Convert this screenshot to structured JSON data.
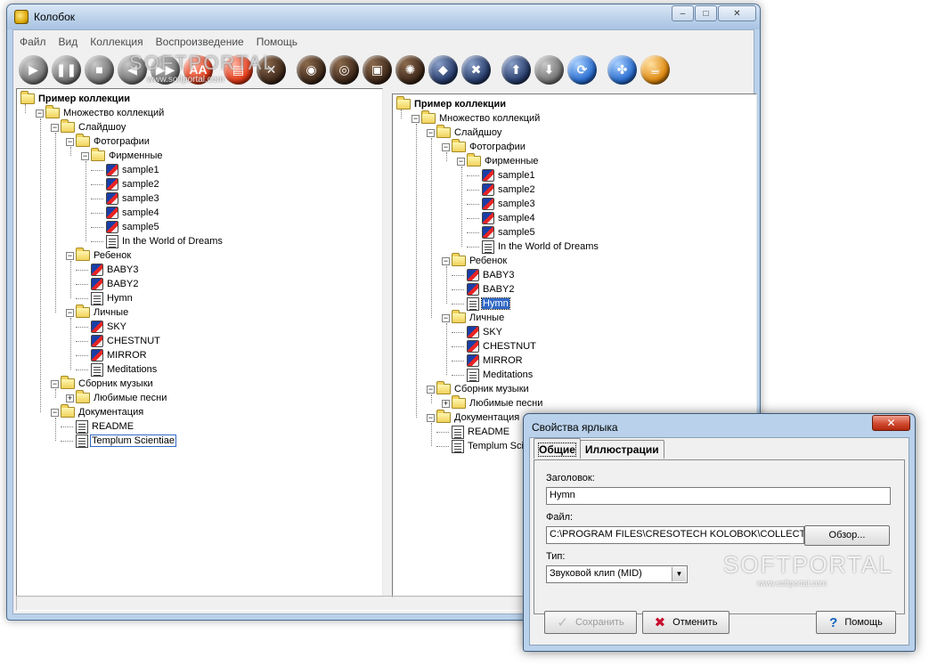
{
  "app": {
    "title": "Колобок",
    "window_buttons": {
      "minimize": "–",
      "maximize": "□",
      "close": "✕"
    },
    "watermark": {
      "logo": "SOFTPORTAL",
      "url": "www.softportal.com"
    }
  },
  "menu": [
    "Файл",
    "Вид",
    "Коллекция",
    "Воспроизведение",
    "Помощь"
  ],
  "toolbar": [
    {
      "name": "play-icon",
      "glyph": "▶",
      "style": "grey"
    },
    {
      "name": "pause-icon",
      "glyph": "❚❚",
      "style": "grey"
    },
    {
      "name": "stop-icon",
      "glyph": "■",
      "style": "grey"
    },
    {
      "name": "previous-icon",
      "glyph": "◀",
      "style": "grey"
    },
    {
      "name": "next-icon",
      "glyph": "▶▶",
      "style": "grey"
    },
    {
      "name": "font-icon",
      "glyph": "AA",
      "style": "red"
    },
    {
      "name": "print-icon",
      "glyph": "▤",
      "style": "red"
    },
    {
      "name": "tools-icon",
      "glyph": "✕",
      "style": "dark"
    },
    {
      "name": "ring-icon",
      "glyph": "◉",
      "style": "dark"
    },
    {
      "name": "ring-alt-icon",
      "glyph": "◎",
      "style": "dark"
    },
    {
      "name": "window-icon",
      "glyph": "▣",
      "style": "dark"
    },
    {
      "name": "settings-icon",
      "glyph": "✺",
      "style": "dark"
    },
    {
      "name": "tag-icon",
      "glyph": "◆",
      "style": "navy"
    },
    {
      "name": "delete-icon",
      "glyph": "✖",
      "style": "navy"
    },
    {
      "name": "move-up-icon",
      "glyph": "⬆",
      "style": "navy"
    },
    {
      "name": "move-down-icon",
      "glyph": "⬇",
      "style": "grey"
    },
    {
      "name": "refresh-icon",
      "glyph": "⟳",
      "style": "blue"
    },
    {
      "name": "fan-icon",
      "glyph": "✤",
      "style": "blue"
    },
    {
      "name": "cup-icon",
      "glyph": "☕",
      "style": "orange"
    }
  ],
  "tree_left": [
    {
      "label": "Пример коллекции",
      "icon": "folder",
      "level": 0,
      "exp": "",
      "bold": true
    },
    {
      "label": "Множество коллекций",
      "icon": "folder",
      "level": 1,
      "exp": "−"
    },
    {
      "label": "Слайдшоу",
      "icon": "folder",
      "level": 2,
      "exp": "−"
    },
    {
      "label": "Фотографии",
      "icon": "folder",
      "level": 3,
      "exp": "−"
    },
    {
      "label": "Фирменные",
      "icon": "folder",
      "level": 4,
      "exp": "−"
    },
    {
      "label": "sample1",
      "icon": "media",
      "level": 5
    },
    {
      "label": "sample2",
      "icon": "media",
      "level": 5
    },
    {
      "label": "sample3",
      "icon": "media",
      "level": 5
    },
    {
      "label": "sample4",
      "icon": "media",
      "level": 5
    },
    {
      "label": "sample5",
      "icon": "media",
      "level": 5
    },
    {
      "label": "In the World of Dreams",
      "icon": "doc",
      "level": 5
    },
    {
      "label": "Ребенок",
      "icon": "folder",
      "level": 3,
      "exp": "−"
    },
    {
      "label": "BABY3",
      "icon": "media",
      "level": 4
    },
    {
      "label": "BABY2",
      "icon": "media",
      "level": 4
    },
    {
      "label": "Hymn",
      "icon": "doc",
      "level": 4
    },
    {
      "label": "Личные",
      "icon": "folder",
      "level": 3,
      "exp": "−"
    },
    {
      "label": "SKY",
      "icon": "media",
      "level": 4
    },
    {
      "label": "CHESTNUT",
      "icon": "media",
      "level": 4
    },
    {
      "label": "MIRROR",
      "icon": "media",
      "level": 4
    },
    {
      "label": "Meditations",
      "icon": "doc",
      "level": 4
    },
    {
      "label": "Сборник музыки",
      "icon": "folder",
      "level": 2,
      "exp": "−"
    },
    {
      "label": "Любимые песни",
      "icon": "folder",
      "level": 3,
      "exp": "+"
    },
    {
      "label": "Документация",
      "icon": "folder",
      "level": 2,
      "exp": "−"
    },
    {
      "label": "README",
      "icon": "doc",
      "level": 3
    },
    {
      "label": "Templum Scientiae",
      "icon": "doc",
      "level": 3,
      "focus": true
    }
  ],
  "tree_right": [
    {
      "label": "Пример коллекции",
      "icon": "folder",
      "level": 0,
      "exp": "",
      "bold": true
    },
    {
      "label": "Множество коллекций",
      "icon": "folder",
      "level": 1,
      "exp": "−"
    },
    {
      "label": "Слайдшоу",
      "icon": "folder",
      "level": 2,
      "exp": "−"
    },
    {
      "label": "Фотографии",
      "icon": "folder",
      "level": 3,
      "exp": "−"
    },
    {
      "label": "Фирменные",
      "icon": "folder",
      "level": 4,
      "exp": "−"
    },
    {
      "label": "sample1",
      "icon": "media",
      "level": 5
    },
    {
      "label": "sample2",
      "icon": "media",
      "level": 5
    },
    {
      "label": "sample3",
      "icon": "media",
      "level": 5
    },
    {
      "label": "sample4",
      "icon": "media",
      "level": 5
    },
    {
      "label": "sample5",
      "icon": "media",
      "level": 5
    },
    {
      "label": "In the World of Dreams",
      "icon": "doc",
      "level": 5
    },
    {
      "label": "Ребенок",
      "icon": "folder",
      "level": 3,
      "exp": "−"
    },
    {
      "label": "BABY3",
      "icon": "media",
      "level": 4
    },
    {
      "label": "BABY2",
      "icon": "media",
      "level": 4
    },
    {
      "label": "Hymn",
      "icon": "doc",
      "level": 4,
      "selected": true
    },
    {
      "label": "Личные",
      "icon": "folder",
      "level": 3,
      "exp": "−"
    },
    {
      "label": "SKY",
      "icon": "media",
      "level": 4
    },
    {
      "label": "CHESTNUT",
      "icon": "media",
      "level": 4
    },
    {
      "label": "MIRROR",
      "icon": "media",
      "level": 4
    },
    {
      "label": "Meditations",
      "icon": "doc",
      "level": 4
    },
    {
      "label": "Сборник музыки",
      "icon": "folder",
      "level": 2,
      "exp": "−"
    },
    {
      "label": "Любимые песни",
      "icon": "folder",
      "level": 3,
      "exp": "+"
    },
    {
      "label": "Документация",
      "icon": "folder",
      "level": 2,
      "exp": "−"
    },
    {
      "label": "README",
      "icon": "doc",
      "level": 3
    },
    {
      "label": "Templum Scientiae",
      "icon": "doc",
      "level": 3
    }
  ],
  "dialog": {
    "title": "Свойства ярлыка",
    "close": "✕",
    "tabs": [
      "Общие",
      "Иллюстрации"
    ],
    "heading_label": "Заголовок:",
    "heading_value": "Hymn",
    "file_label": "Файл:",
    "file_value": "C:\\PROGRAM FILES\\CRESOTECH KOLOBOK\\COLLECTI",
    "browse_label": "Обзор...",
    "type_label": "Тип:",
    "type_value": "Звуковой клип (MID)",
    "type_arrow": "▼",
    "save_label": "Сохранить",
    "cancel_label": "Отменить",
    "help_label": "Помощь",
    "save_icon": "✓",
    "cancel_icon": "✖",
    "help_icon": "?"
  }
}
